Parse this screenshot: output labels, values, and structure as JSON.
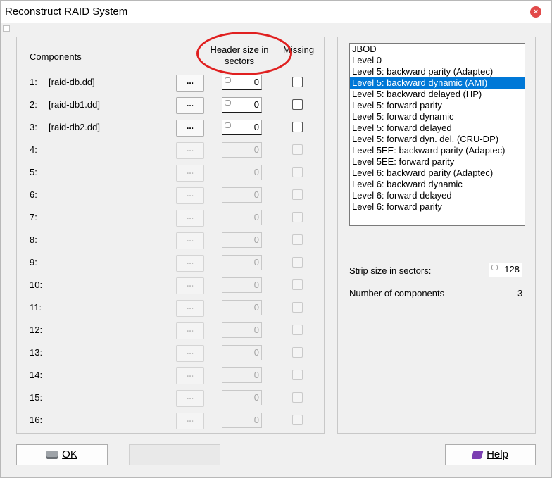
{
  "window": {
    "title": "Reconstruct RAID System",
    "close_glyph": "×"
  },
  "components": {
    "header_label": "Components",
    "header_size_label": "Header size in sectors",
    "missing_label": "Missing",
    "browse_label": "...",
    "rows": [
      {
        "num": "1:",
        "file": "[raid-db.dd]",
        "header": "0",
        "enabled": true
      },
      {
        "num": "2:",
        "file": "[raid-db1.dd]",
        "header": "0",
        "enabled": true
      },
      {
        "num": "3:",
        "file": "[raid-db2.dd]",
        "header": "0",
        "enabled": true
      },
      {
        "num": "4:",
        "file": "",
        "header": "0",
        "enabled": false
      },
      {
        "num": "5:",
        "file": "",
        "header": "0",
        "enabled": false
      },
      {
        "num": "6:",
        "file": "",
        "header": "0",
        "enabled": false
      },
      {
        "num": "7:",
        "file": "",
        "header": "0",
        "enabled": false
      },
      {
        "num": "8:",
        "file": "",
        "header": "0",
        "enabled": false
      },
      {
        "num": "9:",
        "file": "",
        "header": "0",
        "enabled": false
      },
      {
        "num": "10:",
        "file": "",
        "header": "0",
        "enabled": false
      },
      {
        "num": "11:",
        "file": "",
        "header": "0",
        "enabled": false
      },
      {
        "num": "12:",
        "file": "",
        "header": "0",
        "enabled": false
      },
      {
        "num": "13:",
        "file": "",
        "header": "0",
        "enabled": false
      },
      {
        "num": "14:",
        "file": "",
        "header": "0",
        "enabled": false
      },
      {
        "num": "15:",
        "file": "",
        "header": "0",
        "enabled": false
      },
      {
        "num": "16:",
        "file": "",
        "header": "0",
        "enabled": false
      }
    ]
  },
  "raid_levels": {
    "items": [
      "JBOD",
      "Level 0",
      "Level 5: backward parity (Adaptec)",
      "Level 5: backward dynamic (AMI)",
      "Level 5: backward delayed (HP)",
      "Level 5: forward parity",
      "Level 5: forward dynamic",
      "Level 5: forward delayed",
      "Level 5: forward dyn. del. (CRU-DP)",
      "Level 5EE: backward parity (Adaptec)",
      "Level 5EE: forward parity",
      "Level 6: backward parity (Adaptec)",
      "Level 6: backward dynamic",
      "Level 6: forward delayed",
      "Level 6: forward parity"
    ],
    "selected": "Level 5: backward dynamic (AMI)"
  },
  "strip": {
    "label": "Strip size in sectors:",
    "value": "128"
  },
  "num_components": {
    "label": "Number of components",
    "value": "3"
  },
  "buttons": {
    "ok": "OK",
    "help": "Help",
    "blank": ""
  },
  "colors": {
    "selection": "#0078d7",
    "annotation": "#e02020"
  },
  "icons": {
    "ok": "disk-stack-icon",
    "help": "help-book-icon"
  }
}
